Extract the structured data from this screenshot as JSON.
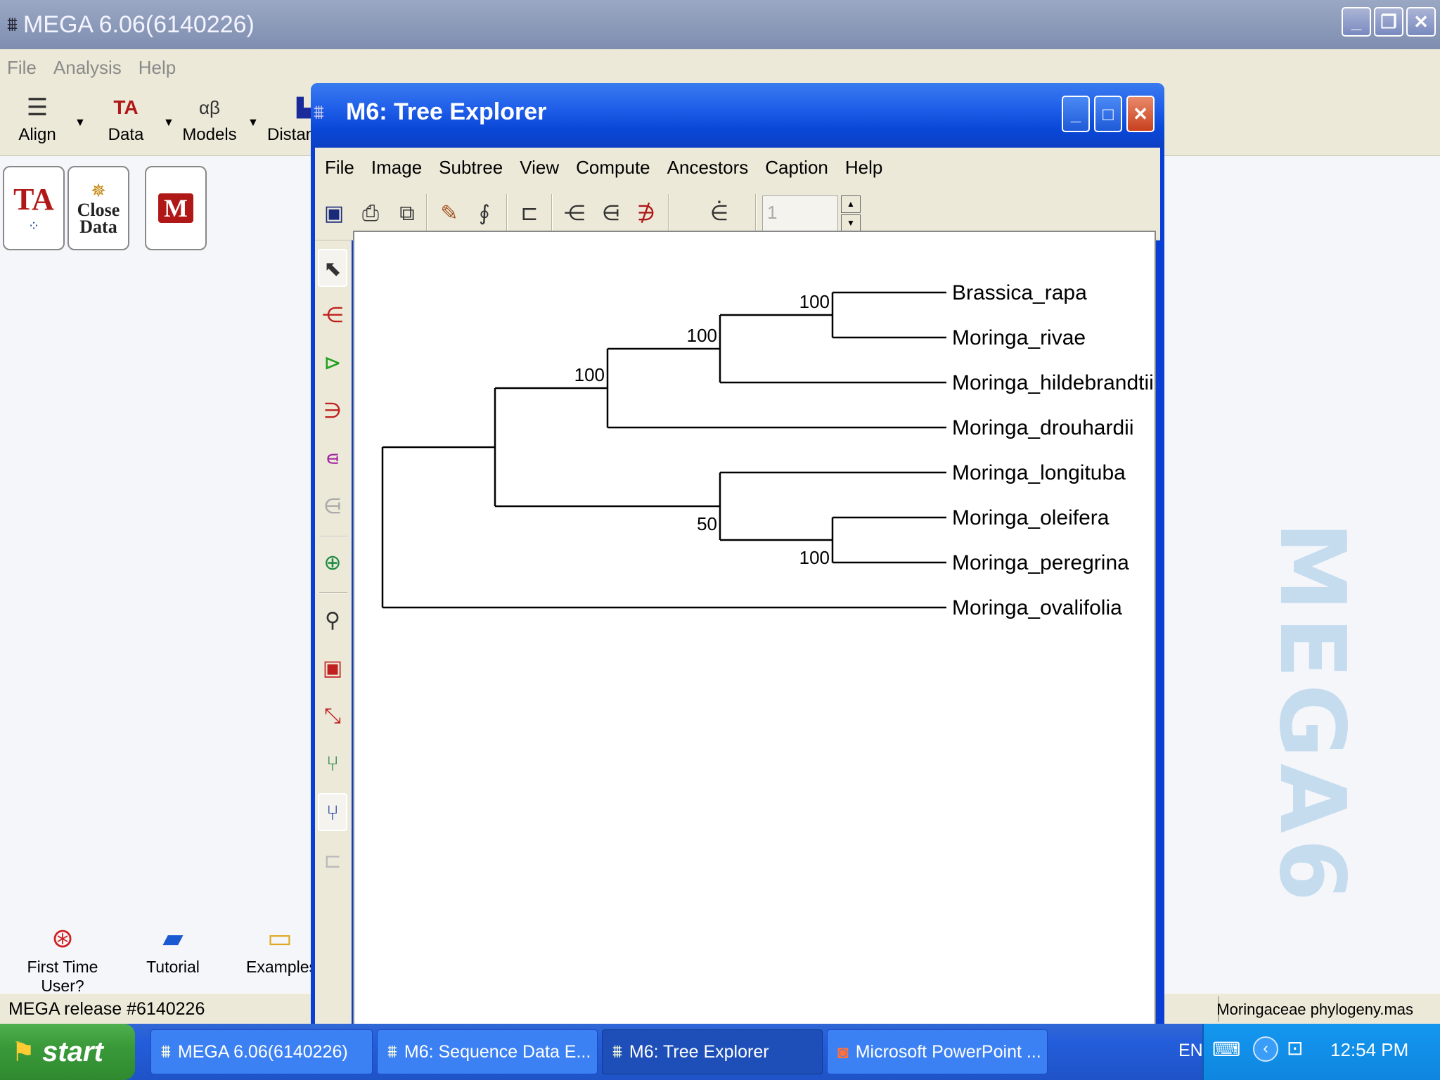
{
  "main_window": {
    "title": "MEGA 6.06(6140226)",
    "menu": [
      "File",
      "Analysis",
      "Help"
    ],
    "toolbar": [
      {
        "label": "Align",
        "icon": "align-icon"
      },
      {
        "label": "Data",
        "icon": "data-icon"
      },
      {
        "label": "Models",
        "icon": "models-icon"
      },
      {
        "label": "Distan",
        "icon": "distance-icon"
      }
    ],
    "quick_buttons": [
      {
        "text": "TA",
        "icon": "alignment-explorer-icon"
      },
      {
        "text": "Close\nData",
        "icon": "close-data-icon"
      },
      {
        "text": "M",
        "icon": "mega-document-icon"
      }
    ],
    "bottom_links": [
      {
        "label": "First Time User?",
        "icon": "lifebuoy-icon"
      },
      {
        "label": "Tutorial",
        "icon": "book-icon"
      },
      {
        "label": "Examples",
        "icon": "folder-icon"
      }
    ],
    "watermark": "MEGA6",
    "status_left": "MEGA release #6140226",
    "status_right": "Moringaceae phylogeny.mas"
  },
  "tree_window": {
    "title": "M6: Tree Explorer",
    "menu": [
      "File",
      "Image",
      "Subtree",
      "View",
      "Compute",
      "Ancestors",
      "Caption",
      "Help"
    ],
    "spin_value": "1",
    "tree": {
      "taxa": [
        "Brassica_rapa",
        "Moringa_rivae",
        "Moringa_hildebrandtii",
        "Moringa_drouhardii",
        "Moringa_longituba",
        "Moringa_oleifera",
        "Moringa_peregrina",
        "Moringa_ovalifolia"
      ],
      "bootstrap": [
        "100",
        "100",
        "100",
        "50",
        "100"
      ]
    }
  },
  "taskbar": {
    "start_label": "start",
    "tasks": [
      {
        "label": "MEGA 6.06(6140226)",
        "active": false
      },
      {
        "label": "M6: Sequence Data E...",
        "active": false
      },
      {
        "label": "M6: Tree Explorer",
        "active": true
      },
      {
        "label": "Microsoft PowerPoint ...",
        "active": false
      }
    ],
    "language": "EN",
    "clock": "12:54 PM"
  },
  "colors": {
    "xp_title_blue": "#0a48d8",
    "start_green": "#3a9a3a",
    "tray_blue": "#0f86e0",
    "watermark": "#c5dcef"
  }
}
